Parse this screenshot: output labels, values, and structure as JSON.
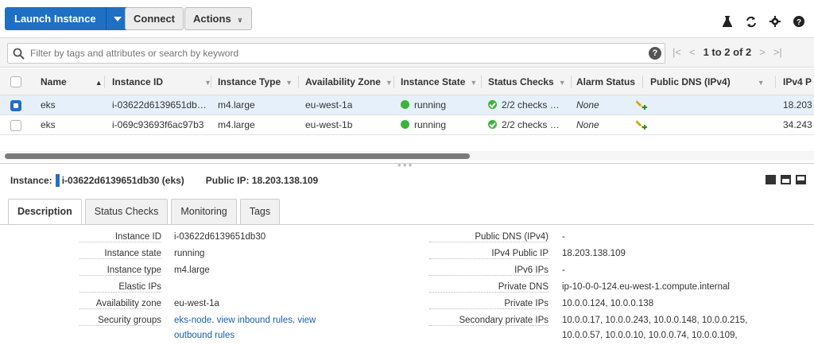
{
  "toolbar": {
    "launch_label": "Launch Instance",
    "connect_label": "Connect",
    "actions_label": "Actions"
  },
  "filter": {
    "placeholder": "Filter by tags and attributes or search by keyword",
    "pagination": "1 to 2 of 2"
  },
  "table": {
    "columns": [
      "Name",
      "Instance ID",
      "Instance Type",
      "Availability Zone",
      "Instance State",
      "Status Checks",
      "Alarm Status",
      "Public DNS (IPv4)",
      "IPv4 P"
    ],
    "rows": [
      {
        "name": "eks",
        "id": "i-03622d6139651db…",
        "type": "m4.large",
        "az": "eu-west-1a",
        "state": "running",
        "checks": "2/2 checks …",
        "alarm": "None",
        "dns": "",
        "ipv4": "18.203",
        "selected": true
      },
      {
        "name": "eks",
        "id": "i-069c93693f6ac97b3",
        "type": "m4.large",
        "az": "eu-west-1b",
        "state": "running",
        "checks": "2/2 checks …",
        "alarm": "None",
        "dns": "",
        "ipv4": "34.243",
        "selected": false
      }
    ]
  },
  "details": {
    "instance_label": "Instance:",
    "instance_value": "i-03622d6139651db30 (eks)",
    "public_ip_line": "Public IP: 18.203.138.109",
    "tabs": [
      "Description",
      "Status Checks",
      "Monitoring",
      "Tags"
    ],
    "left": [
      {
        "k": "Instance ID",
        "v": "i-03622d6139651db30"
      },
      {
        "k": "Instance state",
        "v": "running"
      },
      {
        "k": "Instance type",
        "v": "m4.large"
      },
      {
        "k": "Elastic IPs",
        "v": ""
      },
      {
        "k": "Availability zone",
        "v": "eu-west-1a"
      },
      {
        "k": "Security groups",
        "v": ""
      }
    ],
    "security_groups": {
      "sg": "eks-node",
      "sep1": ". ",
      "inbound": "view inbound rules",
      "sep2": ". ",
      "view": "view",
      "outbound": "outbound rules"
    },
    "right": [
      {
        "k": "Public DNS (IPv4)",
        "v": "-"
      },
      {
        "k": "IPv4 Public IP",
        "v": "18.203.138.109"
      },
      {
        "k": "IPv6 IPs",
        "v": "-"
      },
      {
        "k": "Private DNS",
        "v": "ip-10-0-0-124.eu-west-1.compute.internal"
      },
      {
        "k": "Private IPs",
        "v": "10.0.0.124, 10.0.0.138"
      },
      {
        "k": "Secondary private IPs",
        "v": "10.0.0.17, 10.0.0.243, 10.0.0.148, 10.0.0.215,"
      }
    ],
    "secondary_ips_line2": "10.0.0.57, 10.0.0.10, 10.0.0.74, 10.0.0.109,"
  },
  "colors": {
    "primary": "#1f6fc5",
    "running": "#3ab53a",
    "link": "#1a5fb4"
  },
  "icons": [
    "flask-icon",
    "refresh-icon",
    "gear-icon",
    "help-icon",
    "search-icon",
    "alarm-add-icon"
  ]
}
